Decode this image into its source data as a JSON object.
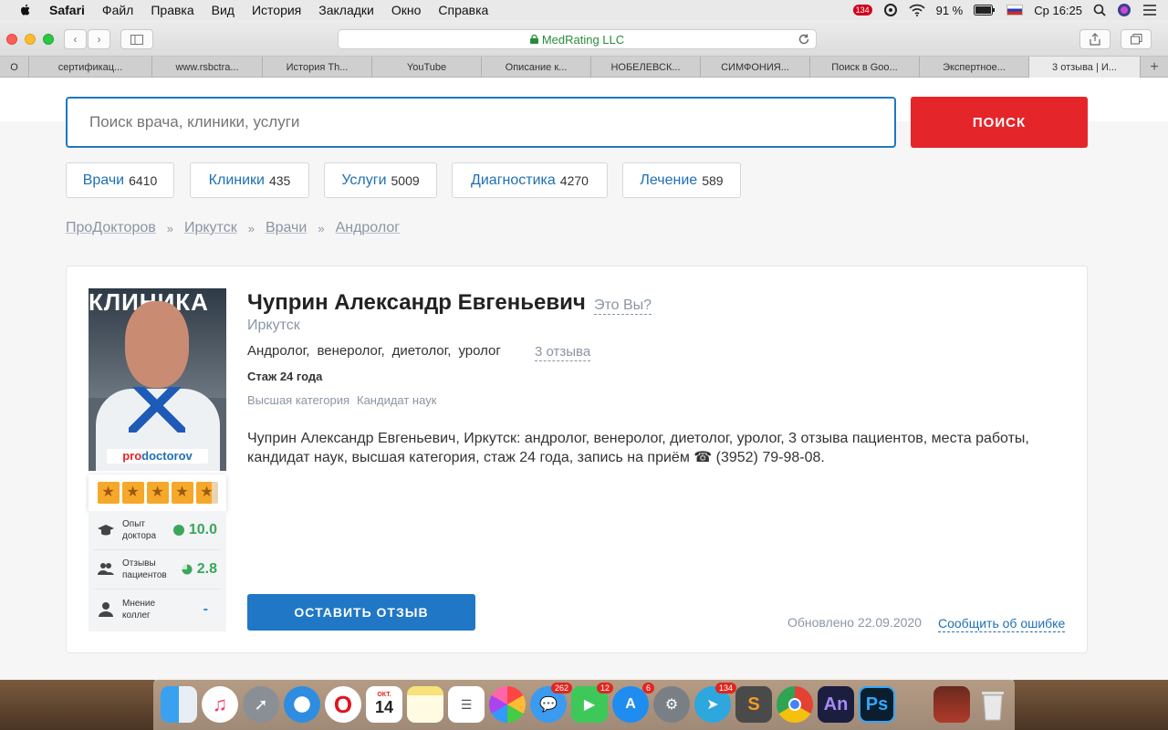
{
  "menubar": {
    "app": "Safari",
    "items": [
      "Файл",
      "Правка",
      "Вид",
      "История",
      "Закладки",
      "Окно",
      "Справка"
    ],
    "notification_count": "134",
    "battery": "91 %",
    "clock": "Ср 16:25"
  },
  "browser": {
    "address": "MedRating LLC",
    "tabs": [
      "О",
      "сертификац...",
      "www.rsbctra...",
      "История Th...",
      "YouTube",
      "Описание к...",
      "НОБЕЛЕВСК...",
      "СИМФОНИЯ...",
      "Поиск в Goo...",
      "Экспертное...",
      "3 отзыва | И..."
    ],
    "active_tab_index": 10
  },
  "search": {
    "placeholder": "Поиск врача, клиники, услуги",
    "button": "ПОИСК"
  },
  "categories": [
    {
      "label": "Врачи",
      "count": "6410"
    },
    {
      "label": "Клиники",
      "count": "435"
    },
    {
      "label": "Услуги",
      "count": "5009"
    },
    {
      "label": "Диагностика",
      "count": "4270"
    },
    {
      "label": "Лечение",
      "count": "589"
    }
  ],
  "breadcrumbs": [
    "ПроДокторов",
    "Иркутск",
    "Врачи",
    "Андролог"
  ],
  "doctor": {
    "name": "Чуприн Александр Евгеньевич",
    "its_you": "Это Вы?",
    "city": "Иркутск",
    "specialties": [
      "Андролог,",
      "венеролог,",
      "диетолог,",
      "уролог"
    ],
    "reviews_link": "3 отзыва",
    "experience": "Стаж 24 года",
    "tags": [
      "Высшая категория",
      "Кандидат наук"
    ],
    "description": "Чуприн Александр Евгеньевич, Иркутск: андролог, венеролог, диетолог, уролог, 3 отзыва пациентов, места работы, кандидат наук, высшая категория, стаж 24 года, запись на приём ☎ (3952) 79-98-08.",
    "photo_sign": "КЛИНИКА",
    "photo_brand_a": "pro",
    "photo_brand_b": "doctorov",
    "rating_stars": 4.7,
    "metrics": [
      {
        "label": "Опыт доктора",
        "value": "10.0",
        "icon": "graduation-cap-icon"
      },
      {
        "label": "Отзывы пациентов",
        "value": "2.8",
        "icon": "patients-icon"
      },
      {
        "label": "Мнение коллег",
        "value": "-",
        "icon": "doctor-icon"
      }
    ],
    "review_button": "ОСТАВИТЬ ОТЗЫВ",
    "updated": "Обновлено 22.09.2020",
    "report_error": "Сообщить об ошибке"
  },
  "dock": {
    "calendar_month": "ОКТ.",
    "calendar_day": "14",
    "badges": {
      "messages": "262",
      "facetime": "12",
      "appstore": "6",
      "telegram": "134"
    },
    "an_label": "An",
    "ps_label": "Ps"
  }
}
